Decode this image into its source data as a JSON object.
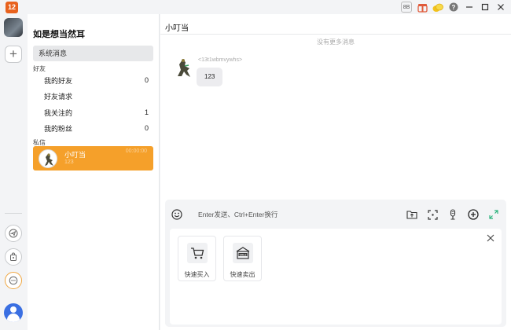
{
  "titlebar": {
    "logo_text": "12",
    "icons": [
      "translate-icon",
      "gift-box-icon",
      "coin-icon",
      "help-icon",
      "minimize-icon",
      "maximize-icon",
      "close-icon"
    ],
    "translate_label": "8B",
    "help_label": "?"
  },
  "rail": {
    "add_label": "+"
  },
  "panel": {
    "title": "如是想当然耳",
    "system_messages": "系统消息",
    "friends_section": "好友",
    "friends": [
      {
        "label": "我的好友",
        "count": "0"
      },
      {
        "label": "好友请求",
        "count": ""
      },
      {
        "label": "我关注的",
        "count": "1"
      },
      {
        "label": "我的粉丝",
        "count": "0"
      }
    ],
    "pm_section": "私信",
    "conversations": [
      {
        "name": "小叮当",
        "time": "00:00:00",
        "preview": "123"
      }
    ]
  },
  "chat": {
    "title": "小叮当",
    "no_more": "没有更多消息",
    "messages": [
      {
        "user": "<13t1wbmvywhs>",
        "text": "123"
      }
    ],
    "input_placeholder": "Enter发送、Ctrl+Enter换行",
    "quick_actions": [
      {
        "label": "快速买入",
        "icon": "shopping-cart-icon"
      },
      {
        "label": "快速卖出",
        "icon": "sale-tag-icon"
      }
    ],
    "sale_icon_text": "SALE"
  },
  "colors": {
    "accent": "#f5a02a",
    "avatar_blue": "#3a6fe2",
    "logo": "#e8621e"
  }
}
